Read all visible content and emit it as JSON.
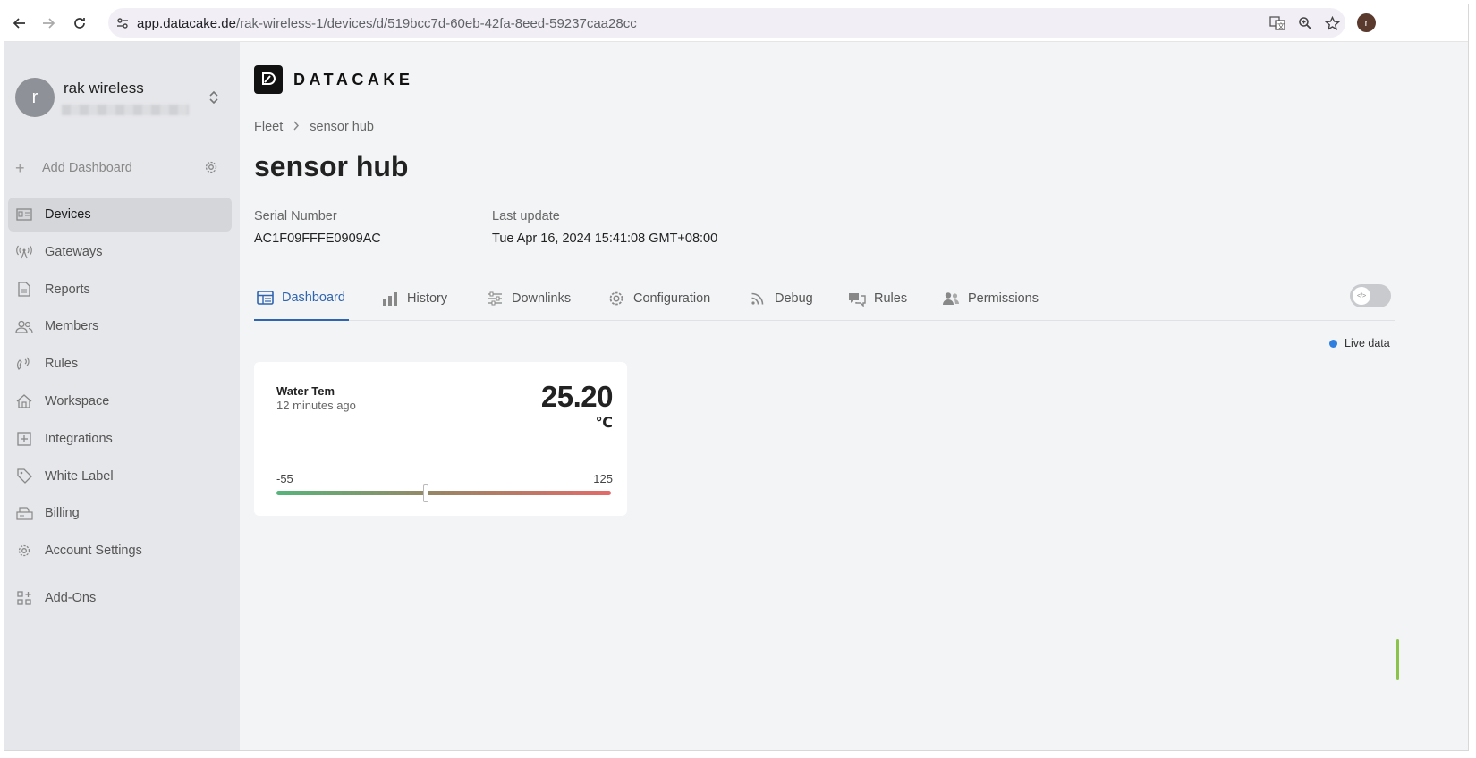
{
  "browser": {
    "url_host": "app.datacake.de",
    "url_path": "/rak-wireless-1/devices/d/519bcc7d-60eb-42fa-8eed-59237caa28cc",
    "profile_initial": "r"
  },
  "sidebar": {
    "avatar_initial": "r",
    "workspace_name": "rak wireless",
    "add_dashboard_label": "Add Dashboard",
    "items": [
      {
        "label": "Devices",
        "icon": "devices-icon",
        "active": true
      },
      {
        "label": "Gateways",
        "icon": "gateway-icon"
      },
      {
        "label": "Reports",
        "icon": "report-icon"
      },
      {
        "label": "Members",
        "icon": "members-icon"
      },
      {
        "label": "Rules",
        "icon": "rules-icon"
      },
      {
        "label": "Workspace",
        "icon": "workspace-icon"
      },
      {
        "label": "Integrations",
        "icon": "integrations-icon"
      },
      {
        "label": "White Label",
        "icon": "tag-icon"
      },
      {
        "label": "Billing",
        "icon": "billing-icon"
      },
      {
        "label": "Account Settings",
        "icon": "gear-icon"
      },
      {
        "label": "Add-Ons",
        "icon": "addons-icon"
      }
    ]
  },
  "main": {
    "logo_text": "DATACAKE",
    "breadcrumb": {
      "root": "Fleet",
      "current": "sensor hub"
    },
    "title": "sensor hub",
    "serial_label": "Serial Number",
    "serial_value": "AC1F09FFFE0909AC",
    "last_update_label": "Last update",
    "last_update_value": "Tue Apr 16, 2024 15:41:08 GMT+08:00",
    "tabs": [
      {
        "label": "Dashboard",
        "icon": "dashboard-icon",
        "active": true
      },
      {
        "label": "History",
        "icon": "bar-chart-icon"
      },
      {
        "label": "Downlinks",
        "icon": "sliders-icon"
      },
      {
        "label": "Configuration",
        "icon": "gear-icon"
      },
      {
        "label": "Debug",
        "icon": "rss-icon"
      },
      {
        "label": "Rules",
        "icon": "chat-icon"
      },
      {
        "label": "Permissions",
        "icon": "users-icon"
      }
    ],
    "live_data_label": "Live data",
    "widget": {
      "title": "Water Tem",
      "time": "12 minutes ago",
      "value": "25.20",
      "unit": "℃",
      "min": "-55",
      "max": "125",
      "gauge_value": 25.2,
      "gauge_min": -55,
      "gauge_max": 125
    }
  },
  "colors": {
    "accent": "#2f64b0",
    "live_dot": "#2f7fe0",
    "gauge_start": "#56b47a",
    "gauge_end": "#e36a68"
  }
}
